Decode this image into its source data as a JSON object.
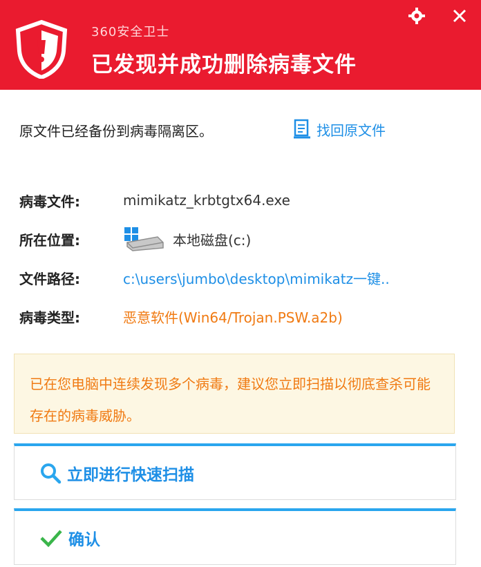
{
  "colors": {
    "header_bg": "#ea1b2f",
    "link_blue": "#1e8fe6",
    "warning_orange": "#f07a12",
    "warning_bg": "#fdf7e3",
    "ok_green": "#3ab54a"
  },
  "header": {
    "app_name": "360安全卫士",
    "title": "已发现并成功删除病毒文件",
    "icons": [
      "shield-icon",
      "gear-icon",
      "close-icon"
    ]
  },
  "backup": {
    "message": "原文件已经备份到病毒隔离区。",
    "restore_label": "找回原文件"
  },
  "details": {
    "file_label": "病毒文件:",
    "file_value": "mimikatz_krbtgtx64.exe",
    "location_label": "所在位置:",
    "location_value": "本地磁盘(c:)",
    "path_label": "文件路径:",
    "path_value": "c:\\users\\jumbo\\desktop\\mimikatz一键..",
    "type_label": "病毒类型:",
    "type_value": "恶意软件(Win64/Trojan.PSW.a2b)"
  },
  "warning": {
    "text": "已在您电脑中连续发现多个病毒，建议您立即扫描以彻底查杀可能存在的病毒威胁。"
  },
  "actions": {
    "scan_label": "立即进行快速扫描",
    "confirm_label": "确认"
  }
}
